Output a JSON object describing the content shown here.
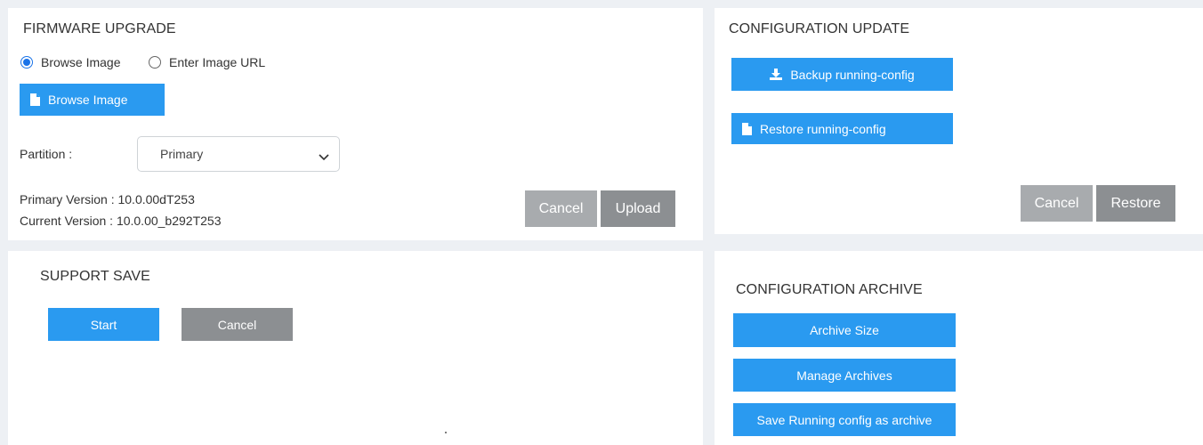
{
  "firmware_upgrade": {
    "title": "FIRMWARE UPGRADE",
    "radio_browse_label": "Browse Image",
    "radio_url_label": "Enter Image URL",
    "selected_mode": "Browse Image",
    "browse_button_label": "Browse Image",
    "partition_label": "Partition :",
    "partition_value": "Primary",
    "primary_version": "Primary Version : 10.0.00dT253",
    "current_version": "Current Version : 10.0.00_b292T253",
    "cancel_label": "Cancel",
    "upload_label": "Upload"
  },
  "configuration_update": {
    "title": "CONFIGURATION UPDATE",
    "backup_label": "Backup running-config",
    "restore_config_label": "Restore running-config",
    "cancel_label": "Cancel",
    "restore_label": "Restore"
  },
  "support_save": {
    "title": "SUPPORT SAVE",
    "start_label": "Start",
    "cancel_label": "Cancel"
  },
  "configuration_archive": {
    "title": "CONFIGURATION ARCHIVE",
    "archive_size_label": "Archive Size",
    "manage_archives_label": "Manage Archives",
    "save_running_label": "Save Running config as archive"
  },
  "colors": {
    "primary_blue": "#2a9af0",
    "gray_button": "#8c8f92",
    "disabled_gray": "#a8abae",
    "background": "#edf0f4"
  },
  "icons": {
    "file": "file-icon",
    "download": "download-icon",
    "chevron": "chevron-down-icon"
  }
}
